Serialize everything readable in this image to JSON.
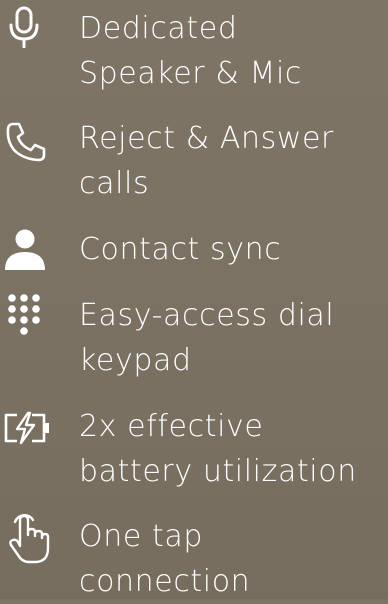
{
  "features": [
    {
      "icon": "microphone-icon",
      "lines": [
        "Dedicated",
        "Speaker & Mic"
      ]
    },
    {
      "icon": "phone-icon",
      "lines": [
        "Reject & Answer",
        "calls"
      ]
    },
    {
      "icon": "contact-person-icon",
      "lines": [
        "Contact sync"
      ]
    },
    {
      "icon": "dial-keypad-icon",
      "lines": [
        "Easy-access dial",
        "keypad"
      ]
    },
    {
      "icon": "battery-charging-icon",
      "lines": [
        "2x effective",
        "battery utilization"
      ]
    },
    {
      "icon": "tap-hand-icon",
      "lines": [
        "One tap",
        "connection"
      ]
    }
  ]
}
